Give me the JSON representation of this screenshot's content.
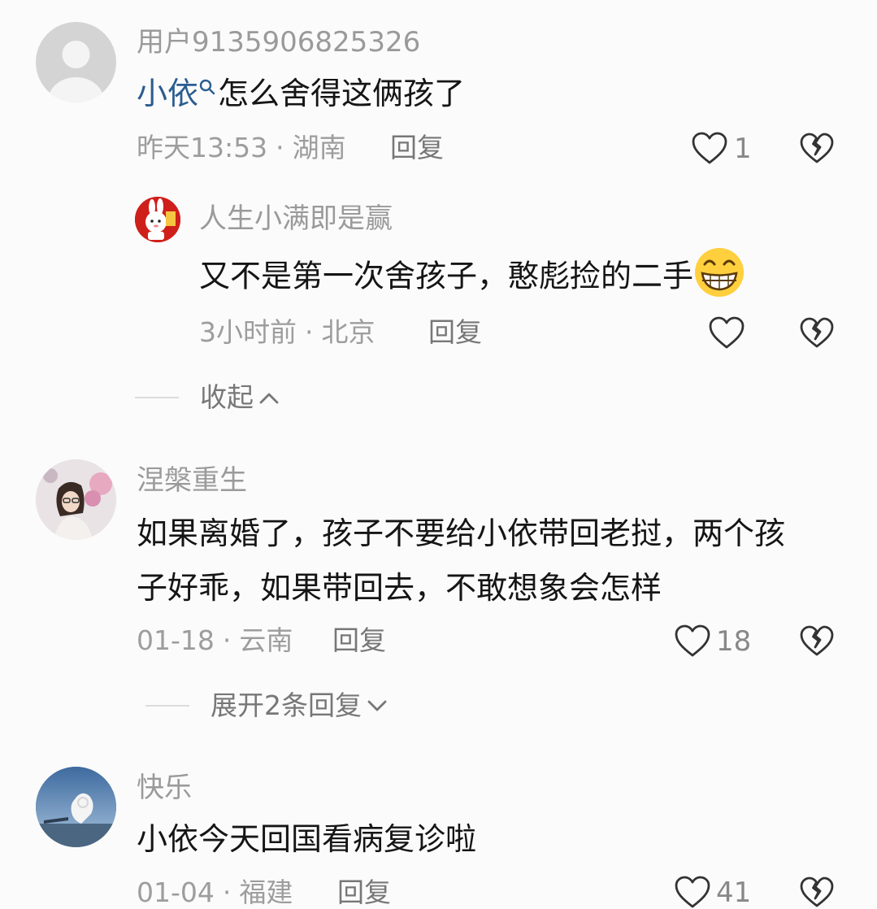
{
  "comments": [
    {
      "username": "用户9135906825326",
      "mention": "小依",
      "text": "怎么舍得这俩孩了",
      "time": "昨天13:53",
      "location": "湖南",
      "reply_label": "回复",
      "likes": "1",
      "avatar": "default-avatar",
      "replies": [
        {
          "username": "人生小满即是赢",
          "text": "又不是第一次舍孩子，憨彪捡的二手",
          "emoji": "grinning-face-icon",
          "time": "3小时前",
          "location": "北京",
          "reply_label": "回复",
          "likes": ""
        }
      ],
      "toggle_label": "收起"
    },
    {
      "username": "涅槃重生",
      "text_line1": "如果离婚了，孩子不要给小依带回老挝，两个孩",
      "text_line2": "子好乖，如果带回去，不敢想象会怎样",
      "time": "01-18",
      "location": "云南",
      "reply_label": "回复",
      "likes": "18",
      "toggle_label": "展开2条回复"
    },
    {
      "username": "快乐",
      "text": "小依今天回国看病复诊啦",
      "time": "01-04",
      "location": "福建",
      "reply_label": "回复",
      "likes": "41"
    }
  ],
  "separator": "·",
  "colors": {
    "mention": "#2b5d8f",
    "meta": "#9d9d9d",
    "text": "#151515"
  }
}
